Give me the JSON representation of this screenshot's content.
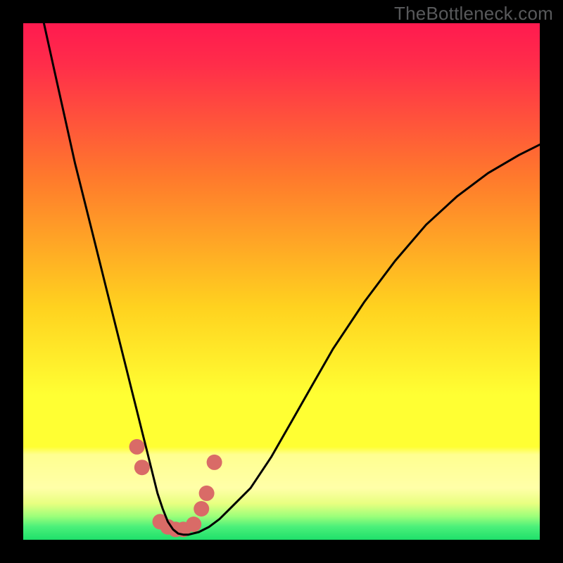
{
  "watermark": "TheBottleneck.com",
  "colors": {
    "gradient_top": "#ff1a4f",
    "gradient_mid1": "#ff6a2e",
    "gradient_mid2": "#ffff33",
    "gradient_band_light": "#ffff80",
    "gradient_bottom": "#29e56f",
    "marker": "#d96b67",
    "curve": "#000000",
    "frame": "#000000"
  },
  "chart_data": {
    "type": "line",
    "title": "",
    "xlabel": "",
    "ylabel": "",
    "xlim": [
      0,
      100
    ],
    "ylim": [
      0,
      100
    ],
    "series": [
      {
        "name": "bottleneck-curve",
        "x": [
          4,
          6,
          8,
          10,
          12,
          14,
          16,
          18,
          20,
          21,
          22,
          23,
          24,
          25,
          26,
          27,
          28,
          29,
          30,
          31,
          32,
          34,
          36,
          38,
          40,
          44,
          48,
          52,
          56,
          60,
          66,
          72,
          78,
          84,
          90,
          96,
          100
        ],
        "y": [
          100,
          91,
          82,
          73,
          65,
          57,
          49,
          41,
          33,
          29,
          25,
          21,
          17,
          13,
          9,
          6,
          3.5,
          2,
          1.2,
          1,
          1,
          1.5,
          2.5,
          4,
          6,
          10,
          16,
          23,
          30,
          37,
          46,
          54,
          61,
          66.5,
          71,
          74.5,
          76.5
        ]
      }
    ],
    "markers": [
      {
        "x": 22,
        "y": 18
      },
      {
        "x": 23,
        "y": 14
      },
      {
        "x": 26.5,
        "y": 3.5
      },
      {
        "x": 28,
        "y": 2.5
      },
      {
        "x": 29.5,
        "y": 2
      },
      {
        "x": 31,
        "y": 2
      },
      {
        "x": 33,
        "y": 3
      },
      {
        "x": 34.5,
        "y": 6
      },
      {
        "x": 35.5,
        "y": 9
      },
      {
        "x": 37,
        "y": 15
      }
    ],
    "grid": false,
    "legend": false
  }
}
